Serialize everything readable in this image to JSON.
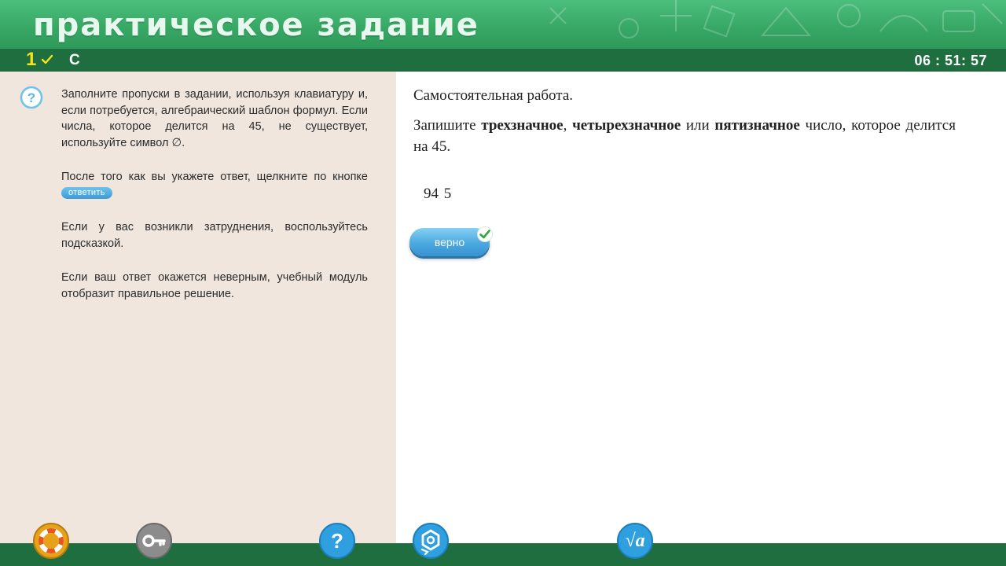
{
  "header": {
    "title": "практическое задание"
  },
  "status": {
    "task_number": "1",
    "task_letter": "С",
    "timer": "06 : 51: 57"
  },
  "instructions": {
    "p1": "Заполните пропуски в задании, используя клавиатуру и, если потребуется, алгебраический шаблон формул. Если числа, которое делится на 45, не существует, используйте символ ∅.",
    "p2_prefix": "После того как вы укажете ответ, щелкните по кнопке",
    "p2_button": "ответить",
    "p3": "Если у вас возникли затруднения, воспользуйтесь подсказкой.",
    "p4": "Если ваш ответ окажется неверным, учебный модуль отобразит правильное решение."
  },
  "work": {
    "title": "Самостоятельная работа.",
    "task_part1": "Запишите ",
    "task_bold1": "трехзначное",
    "task_part2": ", ",
    "task_bold2": "четырехзначное",
    "task_part3": " или ",
    "task_bold3": "пятизначное",
    "task_part4": " число, которое делится на 45.",
    "answer_a": "94",
    "answer_b": "5",
    "result_label": "верно"
  },
  "toolbar": {
    "icons": [
      "lifebuoy-icon",
      "key-icon",
      "help-icon",
      "molecule-icon",
      "sqrt-formula-icon"
    ],
    "formula_glyph": "√a"
  },
  "colors": {
    "banner": "#38a865",
    "statusbar": "#1f6e3f",
    "task_number": "#f4e21a",
    "left_panel": "#f1e6de",
    "accent_blue": "#3a9bd8",
    "check_green": "#2fa83a"
  }
}
